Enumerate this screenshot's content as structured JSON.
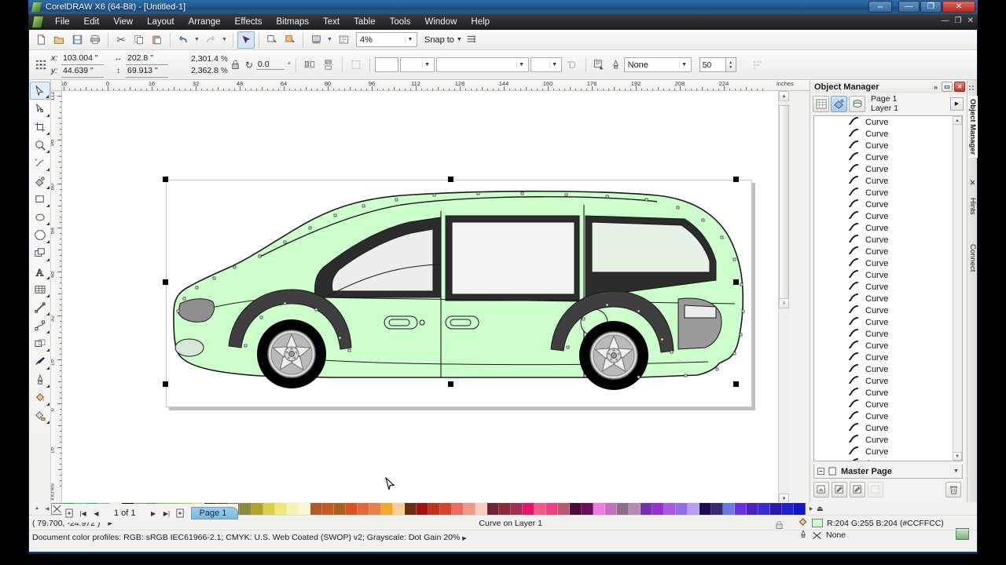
{
  "window": {
    "title": "CorelDRAW X6 (64-Bit) - [Untitled-1]",
    "minimize": "—",
    "maximize": "❐",
    "close": "✕",
    "restore": "⇔"
  },
  "menu": {
    "items": [
      "File",
      "Edit",
      "View",
      "Layout",
      "Arrange",
      "Effects",
      "Bitmaps",
      "Text",
      "Table",
      "Tools",
      "Window",
      "Help"
    ],
    "doc_minimize": "—",
    "doc_maximize": "❐",
    "doc_close": "✕"
  },
  "toolbar": {
    "new": "new-document",
    "open": "open",
    "save": "save",
    "print": "print",
    "cut": "cut",
    "copy": "copy",
    "paste": "paste",
    "undo": "undo",
    "redo": "redo",
    "import": "import",
    "export": "export",
    "publish_pdf": "publish-to-pdf",
    "app_launcher": "application-launcher",
    "zoom_level": "4%",
    "snap_to": "Snap to",
    "options": "options"
  },
  "propbar": {
    "x_label": "x:",
    "x_value": "103.004 \"",
    "y_label": "y:",
    "y_value": "44.639 \"",
    "width_value": "202.8 \"",
    "height_value": "69.913 \"",
    "scale_w": "2,301.4",
    "scale_h": "2,362.8",
    "percent": "%",
    "rotation": "0.0",
    "degree": "°",
    "outline_style_value": "",
    "outline_width_value": "",
    "arrow_value": "",
    "wrap_value": "None",
    "wrap_offset": "50"
  },
  "rulers": {
    "h_labels": [
      "16",
      "0",
      "16",
      "32",
      "48",
      "64",
      "80",
      "96",
      "112",
      "128",
      "144",
      "160",
      "176",
      "192",
      "208",
      "224"
    ],
    "h_unit": "inches",
    "v_labels": [
      "112",
      "96",
      "80",
      "64",
      "48",
      "32",
      "16",
      "0",
      "16"
    ],
    "v_unit": "inches"
  },
  "toolbox": {
    "tools": [
      {
        "name": "pick-tool",
        "glyph": "⬉",
        "selected": true
      },
      {
        "name": "shape-tool",
        "glyph": "⌁",
        "selected": false
      },
      {
        "name": "crop-tool",
        "glyph": "✄",
        "selected": false
      },
      {
        "name": "zoom-tool",
        "glyph": "⌕",
        "selected": false
      },
      {
        "name": "freehand-tool",
        "glyph": "✎",
        "selected": false
      },
      {
        "name": "smart-fill-tool",
        "glyph": "❧",
        "selected": false
      },
      {
        "name": "rectangle-tool",
        "glyph": "▭",
        "selected": false
      },
      {
        "name": "ellipse-tool",
        "glyph": "◯",
        "selected": false
      },
      {
        "name": "polygon-tool",
        "glyph": "⬡",
        "selected": false
      },
      {
        "name": "basic-shapes-tool",
        "glyph": "❏",
        "selected": false
      },
      {
        "name": "text-tool",
        "glyph": "A",
        "selected": false
      },
      {
        "name": "table-tool",
        "glyph": "▦",
        "selected": false
      },
      {
        "name": "dimension-tool",
        "glyph": "⤢",
        "selected": false
      },
      {
        "name": "connector-tool",
        "glyph": "⤬",
        "selected": false
      },
      {
        "name": "blend-tool",
        "glyph": "▱",
        "selected": false
      },
      {
        "name": "color-eyedropper-tool",
        "glyph": "⚲",
        "selected": false
      },
      {
        "name": "outline-tool",
        "glyph": "✒",
        "selected": false
      },
      {
        "name": "fill-tool",
        "glyph": "◈",
        "selected": false
      },
      {
        "name": "interactive-fill-tool",
        "glyph": "◧",
        "selected": false
      }
    ]
  },
  "canvas": {
    "artwork": "minivan-vector-drawing",
    "body_color": "#ccffcc",
    "window_glass_color": "#e9e9e9",
    "tire_color": "#000000",
    "rim_color": "#c9c9c9",
    "taillight_color": "#9a9a9a",
    "outline_color": "#1a1a1a"
  },
  "pagenav": {
    "add_page_start": "add-page-before",
    "first": "|◀",
    "prev": "◀",
    "count": "1 of 1",
    "next": "▶",
    "last": "▶|",
    "add_page_end": "add-page-after",
    "tab_label": "Page 1"
  },
  "docker": {
    "title": "Object Manager",
    "chevrons": "»",
    "minimize": "▭",
    "close": "✕",
    "show_object_properties": "show-object-properties",
    "edit_across_layers": "edit-across-layers",
    "layer_manager_view": "layer-manager-view",
    "page_label": "Page 1",
    "layer_label": "Layer 1",
    "options_arrow": "▶",
    "objects": [
      "Curve",
      "Curve",
      "Curve",
      "Curve",
      "Curve",
      "Curve",
      "Curve",
      "Curve",
      "Curve",
      "Curve",
      "Curve",
      "Curve",
      "Curve",
      "Curve",
      "Curve",
      "Curve",
      "Curve",
      "Curve",
      "Curve",
      "Curve",
      "Curve",
      "Curve",
      "Curve",
      "Curve",
      "Curve",
      "Curve",
      "Curve",
      "Curve",
      "Curve",
      "Curve",
      "Curve",
      "Curve",
      "Curve"
    ],
    "selected_index": 32,
    "master_page": "Master Page",
    "new_layer": "new-layer",
    "new_master_layer": "new-master-layer",
    "new_master_layer_all": "new-master-layer-all-pages",
    "layer_props": "layer-properties",
    "delete": "delete-layer"
  },
  "dockstrip": {
    "tabs": [
      "Object Manager",
      "Hints",
      "Connect"
    ],
    "active": "Object Manager",
    "close_x": "✕"
  },
  "palette": {
    "none_label": "No color",
    "scroll_up": "▲",
    "current_index": 5,
    "colors": [
      "#00a94f",
      "#2fd39a",
      "#16b07e",
      "#9fb497",
      "#ccffcc",
      "#9fd9a0",
      "#74a05a",
      "#5a8a3a",
      "#7bbf4e",
      "#92c83d",
      "#8fe033",
      "#cfe96a",
      "#2b3b12",
      "#4b4b20",
      "#7d7c44",
      "#8e8a3c",
      "#b0a22a",
      "#d8cf4a",
      "#efe87a",
      "#f6f2b0",
      "#f9f6d8",
      "#b05a2a",
      "#c35d22",
      "#a8611e",
      "#d9531e",
      "#e2693a",
      "#e6814d",
      "#efaa27",
      "#f3cf9a",
      "#6b2f14",
      "#9e1414",
      "#c0321a",
      "#d4452a",
      "#e8705a",
      "#ef9a86",
      "#f6cdbe",
      "#6e2436",
      "#8b2a3c",
      "#a13152",
      "#e8136b",
      "#ee5a8a",
      "#ee3f7e",
      "#b35a72",
      "#4a0a3c",
      "#6a0f58",
      "#f07ae0",
      "#c570bd",
      "#8f6b8c",
      "#b58bb0",
      "#7331b0",
      "#9a2fd0",
      "#a85ae0",
      "#8f6ee8",
      "#b79ef2",
      "#1a0b52",
      "#3a2a72",
      "#6a7ae0",
      "#6a2fe0",
      "#4a22c0",
      "#3a2ad0",
      "#2a1aa8",
      "#2020d0",
      "#1414c8"
    ]
  },
  "statusbar": {
    "coordinates": "( 79.700, -24.972 )",
    "coord_caret": "▶",
    "object_info": "Curve on Layer 1",
    "color_profiles": "Document color profiles: RGB: sRGB IEC61966-2.1; CMYK: U.S. Web Coated (SWOP) v2; Grayscale: Dot Gain 20%",
    "profiles_caret": "▶",
    "fill_info": "R:204 G:255 B:204 (#CCFFCC)",
    "fill_swatch": "#ccffcc",
    "outline_info": "None",
    "doc_palette_button": "document-palette"
  }
}
